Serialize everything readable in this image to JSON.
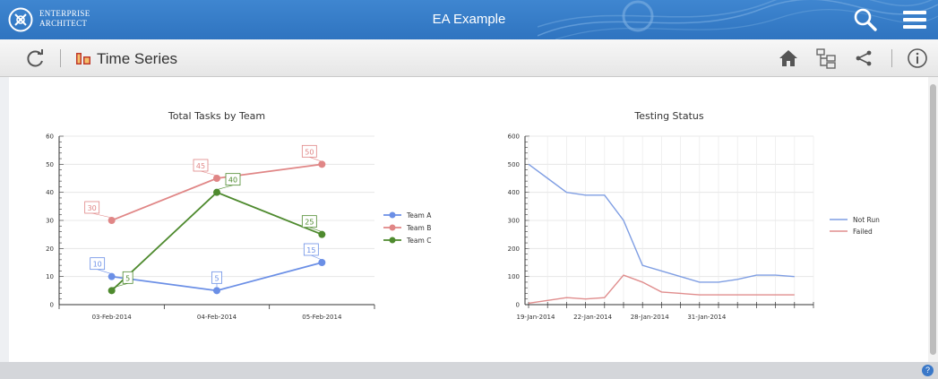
{
  "app": {
    "brand_line1": "ENTERPRISE",
    "brand_line2": "ARCHITECT",
    "title": "EA Example",
    "icons": [
      "ea-logo-icon",
      "search-icon",
      "hamburger-menu-icon"
    ]
  },
  "toolbar": {
    "title": "Time Series",
    "icons": [
      "refresh-icon",
      "time-series-icon",
      "home-icon",
      "hierarchy-icon",
      "share-icon",
      "info-icon"
    ]
  },
  "status": {
    "help_label": "?"
  },
  "colors": {
    "topbar": "#2f74c0",
    "team_a": "#6b8fe6",
    "team_b": "#e08686",
    "team_c": "#4e8a2e",
    "not_run": "#7f9ee3",
    "failed": "#e08d8d"
  },
  "chart_data": [
    {
      "type": "line",
      "title": "Total Tasks by Team",
      "categories": [
        "03-Feb-2014",
        "04-Feb-2014",
        "05-Feb-2014"
      ],
      "ylim": [
        0,
        60
      ],
      "y_ticks": [
        "0",
        "10",
        "20",
        "30",
        "40",
        "50",
        "60"
      ],
      "grid": true,
      "legend_position": "right",
      "series": [
        {
          "name": "Team A",
          "values": [
            10,
            5,
            15
          ],
          "labels": [
            "10",
            "5",
            "15"
          ],
          "color": "#6b8fe6"
        },
        {
          "name": "Team B",
          "values": [
            30,
            45,
            50
          ],
          "labels": [
            "30",
            "45",
            "50"
          ],
          "color": "#e08686"
        },
        {
          "name": "Team C",
          "values": [
            5,
            40,
            25
          ],
          "labels": [
            "5",
            "40",
            "25"
          ],
          "color": "#4e8a2e"
        }
      ]
    },
    {
      "type": "line",
      "title": "Testing Status",
      "x_ticks": [
        "19-Jan-2014",
        "22-Jan-2014",
        "28-Jan-2014",
        "31-Jan-2014"
      ],
      "ylim": [
        0,
        600
      ],
      "y_ticks": [
        "0",
        "100",
        "200",
        "300",
        "400",
        "500",
        "600"
      ],
      "grid": true,
      "legend_position": "right",
      "series": [
        {
          "name": "Not Run",
          "color": "#7f9ee3",
          "x": [
            "2014-01-19",
            "2014-01-20",
            "2014-01-21",
            "2014-01-22",
            "2014-01-23",
            "2014-01-24",
            "2014-01-25",
            "2014-01-26",
            "2014-01-27",
            "2014-01-28",
            "2014-01-29",
            "2014-01-30",
            "2014-01-31",
            "2014-02-01",
            "2014-02-02"
          ],
          "values": [
            500,
            450,
            400,
            390,
            390,
            300,
            140,
            120,
            100,
            80,
            80,
            90,
            105,
            105,
            100
          ]
        },
        {
          "name": "Failed",
          "color": "#e08d8d",
          "x": [
            "2014-01-19",
            "2014-01-20",
            "2014-01-21",
            "2014-01-22",
            "2014-01-23",
            "2014-01-24",
            "2014-01-25",
            "2014-01-26",
            "2014-01-27",
            "2014-01-28",
            "2014-01-29",
            "2014-01-30",
            "2014-01-31",
            "2014-02-01",
            "2014-02-02"
          ],
          "values": [
            5,
            15,
            25,
            20,
            25,
            105,
            80,
            45,
            40,
            35,
            35,
            35,
            35,
            35,
            35
          ]
        }
      ]
    }
  ]
}
